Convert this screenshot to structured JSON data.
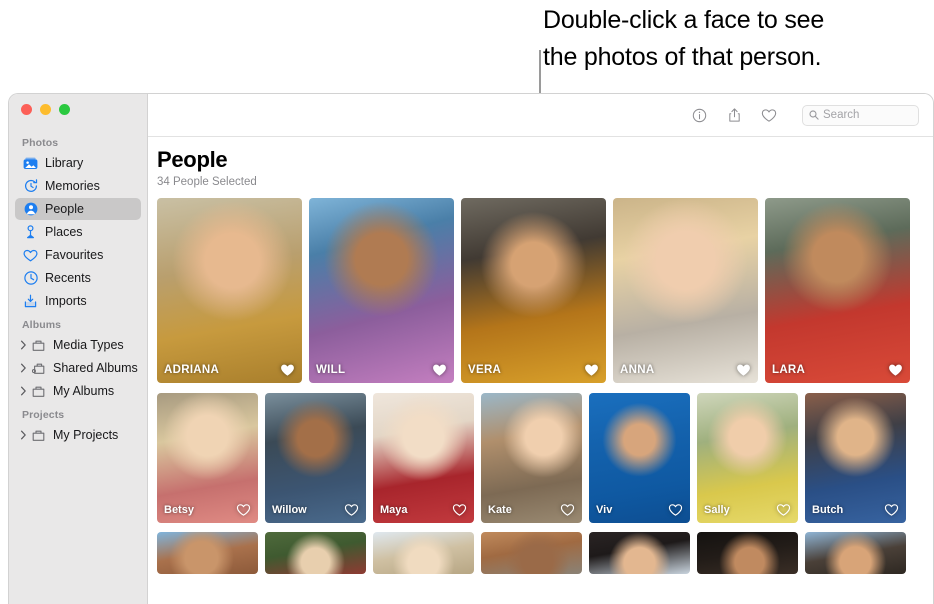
{
  "callout": {
    "line1": "Double-click a face to see",
    "line2": "the photos of that person."
  },
  "window": {
    "traffic_lights": [
      "close",
      "minimize",
      "zoom"
    ]
  },
  "sidebar": {
    "sections": [
      {
        "title": "Photos",
        "items": [
          {
            "label": "Library",
            "icon": "library-icon",
            "selected": false,
            "disclosure": false
          },
          {
            "label": "Memories",
            "icon": "memories-icon",
            "selected": false,
            "disclosure": false
          },
          {
            "label": "People",
            "icon": "people-icon",
            "selected": true,
            "disclosure": false
          },
          {
            "label": "Places",
            "icon": "places-icon",
            "selected": false,
            "disclosure": false
          },
          {
            "label": "Favourites",
            "icon": "heart-icon",
            "selected": false,
            "disclosure": false
          },
          {
            "label": "Recents",
            "icon": "clock-icon",
            "selected": false,
            "disclosure": false
          },
          {
            "label": "Imports",
            "icon": "import-icon",
            "selected": false,
            "disclosure": false
          }
        ]
      },
      {
        "title": "Albums",
        "items": [
          {
            "label": "Media Types",
            "icon": "folder-icon",
            "selected": false,
            "disclosure": true
          },
          {
            "label": "Shared Albums",
            "icon": "shared-folder-icon",
            "selected": false,
            "disclosure": true
          },
          {
            "label": "My Albums",
            "icon": "folder-icon",
            "selected": false,
            "disclosure": true
          }
        ]
      },
      {
        "title": "Projects",
        "items": [
          {
            "label": "My Projects",
            "icon": "folder-icon",
            "selected": false,
            "disclosure": true
          }
        ]
      }
    ]
  },
  "toolbar": {
    "info_label": "Info",
    "share_label": "Share",
    "favourite_label": "Favourite",
    "search_placeholder": "Search"
  },
  "main": {
    "title": "People",
    "subtitle": "34 People Selected"
  },
  "people": {
    "row1": [
      {
        "name": "ADRIANA",
        "favourite": true
      },
      {
        "name": "WILL",
        "favourite": true
      },
      {
        "name": "VERA",
        "favourite": true
      },
      {
        "name": "ANNA",
        "favourite": true
      },
      {
        "name": "LARA",
        "favourite": true
      }
    ],
    "row2": [
      {
        "name": "Betsy",
        "favourite": false
      },
      {
        "name": "Willow",
        "favourite": false
      },
      {
        "name": "Maya",
        "favourite": false
      },
      {
        "name": "Kate",
        "favourite": false
      },
      {
        "name": "Viv",
        "favourite": false
      },
      {
        "name": "Sally",
        "favourite": false
      },
      {
        "name": "Butch",
        "favourite": false
      }
    ],
    "row3": [
      {
        "name": "",
        "favourite": false
      },
      {
        "name": "",
        "favourite": false
      },
      {
        "name": "",
        "favourite": false
      },
      {
        "name": "",
        "favourite": false
      },
      {
        "name": "",
        "favourite": false
      },
      {
        "name": "",
        "favourite": false
      },
      {
        "name": "",
        "favourite": false
      }
    ]
  },
  "colors": {
    "accent_blue": "#1d7ef0",
    "sidebar_bg": "#e9e8e8",
    "selection_bg": "#c9c8c8",
    "title_text": "#000000",
    "secondary_text": "#8a8a8e"
  }
}
